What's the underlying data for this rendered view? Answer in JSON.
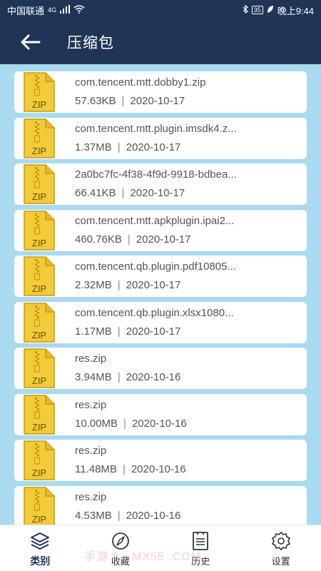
{
  "status_bar": {
    "carrier": "中国联通",
    "network": "4G",
    "battery": "35",
    "time": "晚上9:44"
  },
  "header": {
    "back_icon": "arrow-left-icon",
    "title": "压缩包"
  },
  "file_icon": {
    "name": "zip-file-icon",
    "label": "ZIP"
  },
  "files": [
    {
      "name": "com.tencent.mtt.dobby1.zip",
      "size": "57.63KB",
      "date": "2020-10-17"
    },
    {
      "name": "com.tencent.mtt.plugin.imsdk4.z...",
      "size": "1.37MB",
      "date": "2020-10-17"
    },
    {
      "name": "2a0bc7fc-4f38-4f9d-9918-bdbea...",
      "size": "66.41KB",
      "date": "2020-10-17"
    },
    {
      "name": "com.tencent.mtt.apkplugin.ipai2...",
      "size": "460.76KB",
      "date": "2020-10-17"
    },
    {
      "name": "com.tencent.qb.plugin.pdf10805...",
      "size": "2.32MB",
      "date": "2020-10-17"
    },
    {
      "name": "com.tencent.qb.plugin.xlsx1080...",
      "size": "1.17MB",
      "date": "2020-10-17"
    },
    {
      "name": "res.zip",
      "size": "3.94MB",
      "date": "2020-10-16"
    },
    {
      "name": "res.zip",
      "size": "10.00MB",
      "date": "2020-10-16"
    },
    {
      "name": "res.zip",
      "size": "11.48MB",
      "date": "2020-10-16"
    },
    {
      "name": "res.zip",
      "size": "4.53MB",
      "date": "2020-10-16"
    }
  ],
  "meta_separator": "|",
  "bottom_nav": [
    {
      "label": "类别",
      "icon": "layers-icon",
      "active": true
    },
    {
      "label": "收藏",
      "icon": "compass-icon",
      "active": false
    },
    {
      "label": "历史",
      "icon": "document-list-icon",
      "active": false
    },
    {
      "label": "设置",
      "icon": "gear-icon",
      "active": false
    }
  ],
  "watermark": "手游 8 • MX55 .COM",
  "colors": {
    "header_bg": "#1f3556",
    "list_bg": "#a9daf0",
    "zip_icon_fill": "#f2cb3b",
    "zip_icon_stroke": "#c59a12"
  }
}
